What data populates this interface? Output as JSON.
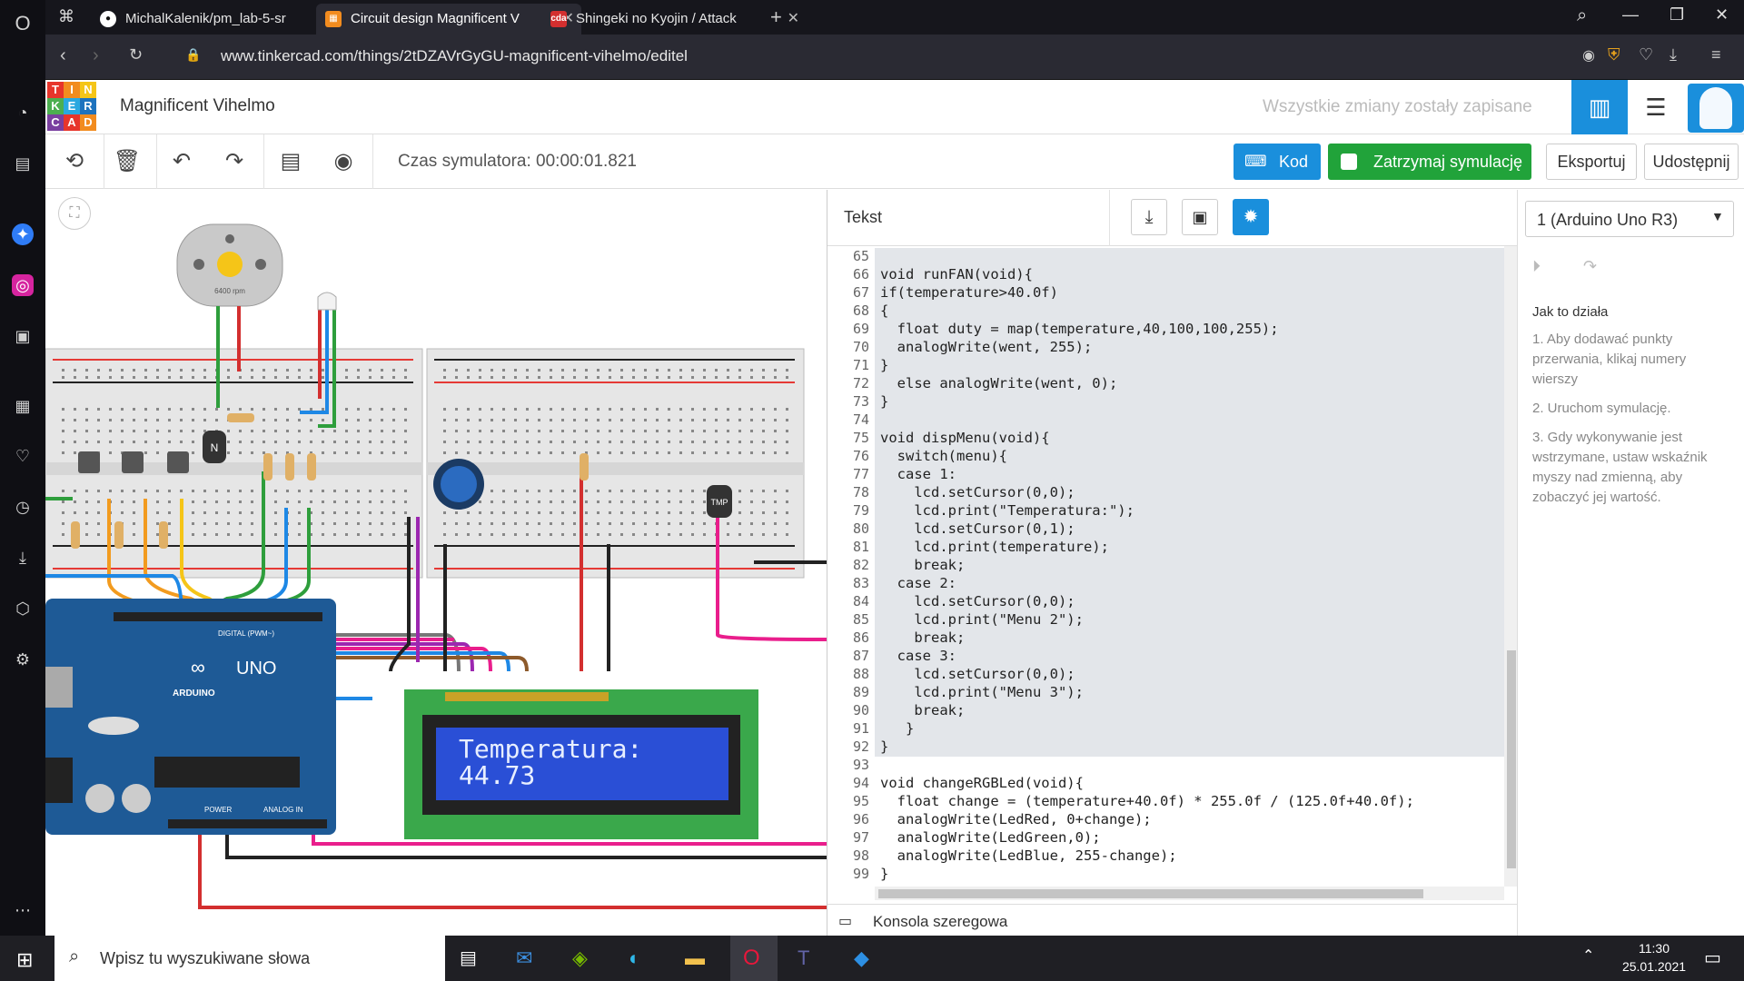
{
  "browser": {
    "tabs": [
      {
        "label": "MichalKalenik/pm_lab-5-sr",
        "favicon": "github-icon"
      },
      {
        "label": "Circuit design Magnificent V",
        "favicon": "tinkercad-icon",
        "active": true
      },
      {
        "label": "Shingeki no Kyojin / Attack",
        "favicon": "cda-icon"
      }
    ],
    "cda_favicon_text": "cda",
    "url": "www.tinkercad.com/things/2tDZAVrGyGU-magnificent-vihelmo/editel"
  },
  "header": {
    "logo_letters": [
      "T",
      "I",
      "N",
      "K",
      "E",
      "R",
      "C",
      "A",
      "D"
    ],
    "logo_colors": [
      "#e7352b",
      "#f28c1f",
      "#f5c518",
      "#4caf50",
      "#2aa8e0",
      "#1e73be",
      "#7a3fa0",
      "#e7352b",
      "#f28c1f"
    ],
    "project_title": "Magnificent Vihelmo",
    "save_status": "Wszystkie zmiany zostały zapisane"
  },
  "toolbar": {
    "sim_time": "Czas symulatora: 00:00:01.821",
    "code_button": "Kod",
    "stop_sim_button": "Zatrzymaj symulację",
    "export_button": "Eksportuj",
    "share_button": "Udostępnij"
  },
  "canvas": {
    "fan_label": "6400 rpm",
    "lcd_line1": "Temperatura:",
    "lcd_line2": "44.73",
    "arduino_brand": "ARDUINO",
    "arduino_model": "UNO",
    "digital_label": "DIGITAL (PWM~)",
    "power_label": "POWER",
    "analog_label": "ANALOG IN",
    "tmp_label": "TMP",
    "transistor_label": "N"
  },
  "code_panel": {
    "mode_label": "Tekst",
    "device_select": "1 (Arduino Uno R3)",
    "lines": [
      {
        "n": "65",
        "t": ""
      },
      {
        "n": "66",
        "t": "void runFAN(void){"
      },
      {
        "n": "67",
        "t": "if(temperature>40.0f)"
      },
      {
        "n": "68",
        "t": "{"
      },
      {
        "n": "69",
        "t": "  float duty = map(temperature,40,100,100,255);"
      },
      {
        "n": "70",
        "t": "  analogWrite(went, 255);"
      },
      {
        "n": "71",
        "t": "}"
      },
      {
        "n": "72",
        "t": "  else analogWrite(went, 0);"
      },
      {
        "n": "73",
        "t": "}"
      },
      {
        "n": "74",
        "t": ""
      },
      {
        "n": "75",
        "t": "void dispMenu(void){"
      },
      {
        "n": "76",
        "t": "  switch(menu){"
      },
      {
        "n": "77",
        "t": "  case 1:"
      },
      {
        "n": "78",
        "t": "    lcd.setCursor(0,0);"
      },
      {
        "n": "79",
        "t": "    lcd.print(\"Temperatura:\");"
      },
      {
        "n": "80",
        "t": "    lcd.setCursor(0,1);"
      },
      {
        "n": "81",
        "t": "    lcd.print(temperature);"
      },
      {
        "n": "82",
        "t": "    break;"
      },
      {
        "n": "83",
        "t": "  case 2:"
      },
      {
        "n": "84",
        "t": "    lcd.setCursor(0,0);"
      },
      {
        "n": "85",
        "t": "    lcd.print(\"Menu 2\");"
      },
      {
        "n": "86",
        "t": "    break;"
      },
      {
        "n": "87",
        "t": "  case 3:"
      },
      {
        "n": "88",
        "t": "    lcd.setCursor(0,0);"
      },
      {
        "n": "89",
        "t": "    lcd.print(\"Menu 3\");"
      },
      {
        "n": "90",
        "t": "    break;"
      },
      {
        "n": "91",
        "t": "   }"
      },
      {
        "n": "92",
        "t": "}"
      },
      {
        "n": "93",
        "t": ""
      },
      {
        "n": "94",
        "t": "void changeRGBLed(void){"
      },
      {
        "n": "95",
        "t": "  float change = (temperature+40.0f) * 255.0f / (125.0f+40.0f);"
      },
      {
        "n": "96",
        "t": "  analogWrite(LedRed, 0+change);"
      },
      {
        "n": "97",
        "t": "  analogWrite(LedGreen,0);"
      },
      {
        "n": "98",
        "t": "  analogWrite(LedBlue, 255-change);"
      },
      {
        "n": "99",
        "t": "}"
      }
    ],
    "serial_console": "Konsola szeregowa"
  },
  "debugger": {
    "heading": "Jak to działa",
    "steps": [
      "1. Aby dodawać punkty przerwania, klikaj numery wierszy",
      "2. Uruchom symulację.",
      "3. Gdy wykonywanie jest wstrzymane, ustaw wskaźnik myszy nad zmienną, aby zobaczyć jej wartość."
    ]
  },
  "taskbar": {
    "search_placeholder": "Wpisz tu wyszukiwane słowa",
    "time": "11:30",
    "date": "25.01.2021"
  }
}
